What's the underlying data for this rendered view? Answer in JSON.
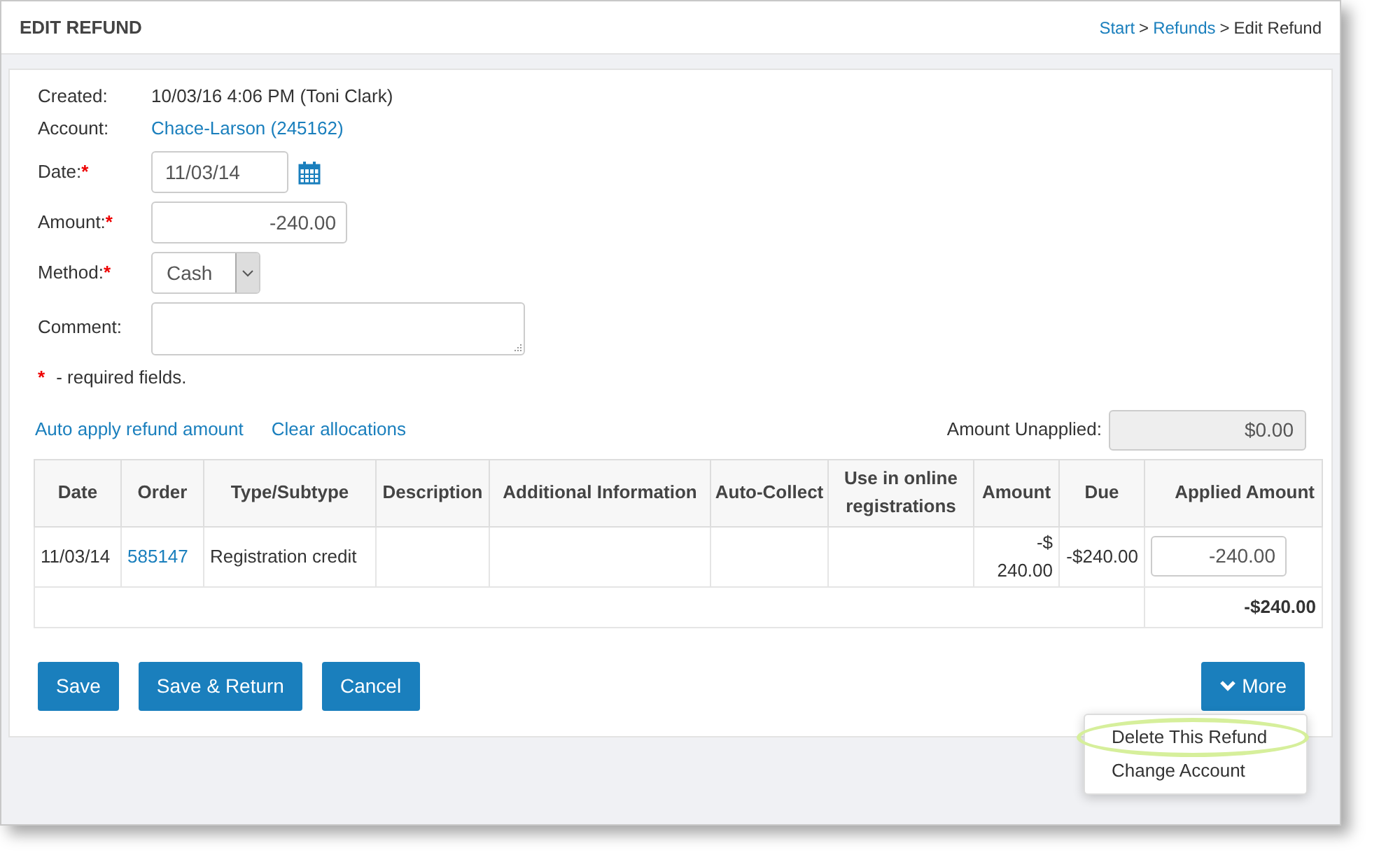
{
  "page": {
    "title": "EDIT REFUND"
  },
  "breadcrumb": [
    {
      "kind": "link",
      "text": "Start"
    },
    {
      "kind": "separator",
      "text": ">"
    },
    {
      "kind": "link",
      "text": "Refunds"
    },
    {
      "kind": "separator",
      "text": ">"
    },
    {
      "kind": "current",
      "text": "Edit Refund"
    }
  ],
  "info": [
    {
      "kind": "text",
      "label": "Created:",
      "value": "10/03/16 4:06 PM (Toni Clark)"
    },
    {
      "kind": "link",
      "label": "Account:",
      "value": "Chace-Larson (245162)"
    }
  ],
  "fields": [
    {
      "kind": "date",
      "label": "Date:",
      "marker": "*",
      "value": "11/03/14"
    },
    {
      "kind": "amount",
      "label": "Amount:",
      "marker": "*",
      "value": "-240.00"
    },
    {
      "kind": "select",
      "label": "Method:",
      "marker": "*",
      "value": "Cash"
    },
    {
      "kind": "textarea",
      "label": "Comment:"
    }
  ],
  "required_note": {
    "marker": "*",
    "text": "- required fields."
  },
  "actions": [
    "Auto apply refund amount",
    "Clear allocations"
  ],
  "unapplied": {
    "label": "Amount Unapplied:",
    "value": "$0.00"
  },
  "table": {
    "columns": [
      {
        "label": "Date",
        "kind": "text"
      },
      {
        "label": "Order",
        "kind": "link"
      },
      {
        "label": "Type/Subtype",
        "kind": "text"
      },
      {
        "label": "Description",
        "kind": "text"
      },
      {
        "label": "Additional Information",
        "kind": "text"
      },
      {
        "label": "Auto-Collect",
        "kind": "text"
      },
      {
        "label": "Use in online registrations",
        "kind": "text"
      },
      {
        "label": "Amount",
        "kind": "text"
      },
      {
        "label": "Due",
        "kind": "text"
      },
      {
        "label": "Applied Amount",
        "kind": "input"
      }
    ],
    "rows": [
      [
        "11/03/14",
        "585147",
        "Registration credit",
        "",
        "",
        "",
        "",
        "-$ 240.00",
        "-$240.00",
        "-240.00"
      ]
    ],
    "total": "-$240.00"
  },
  "buttons": [
    "Save",
    "Save & Return",
    "Cancel"
  ],
  "more": {
    "label": "More",
    "expanded": true
  },
  "menu": [
    {
      "label": "Delete This Refund",
      "highlighted": true
    },
    {
      "label": "Change Account",
      "highlighted": false
    }
  ]
}
